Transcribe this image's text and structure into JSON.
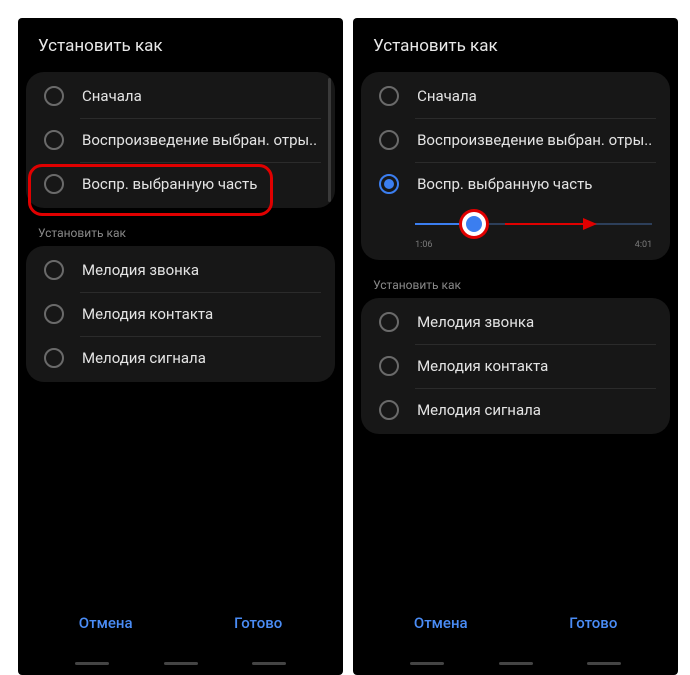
{
  "left": {
    "header": "Установить как",
    "playback": [
      "Сначала",
      "Воспроизведение выбран. отры..",
      "Воспр. выбранную часть"
    ],
    "sub_header": "Установить как",
    "set_as": [
      "Мелодия звонка",
      "Мелодия контакта",
      "Мелодия сигнала"
    ],
    "cancel": "Отмена",
    "done": "Готово"
  },
  "right": {
    "header": "Установить как",
    "playback": [
      "Сначала",
      "Воспроизведение выбран. отры..",
      "Воспр. выбранную часть"
    ],
    "slider": {
      "start": "1:06",
      "end": "4:01"
    },
    "sub_header": "Установить как",
    "set_as": [
      "Мелодия звонка",
      "Мелодия контакта",
      "Мелодия сигнала"
    ],
    "cancel": "Отмена",
    "done": "Готово"
  }
}
